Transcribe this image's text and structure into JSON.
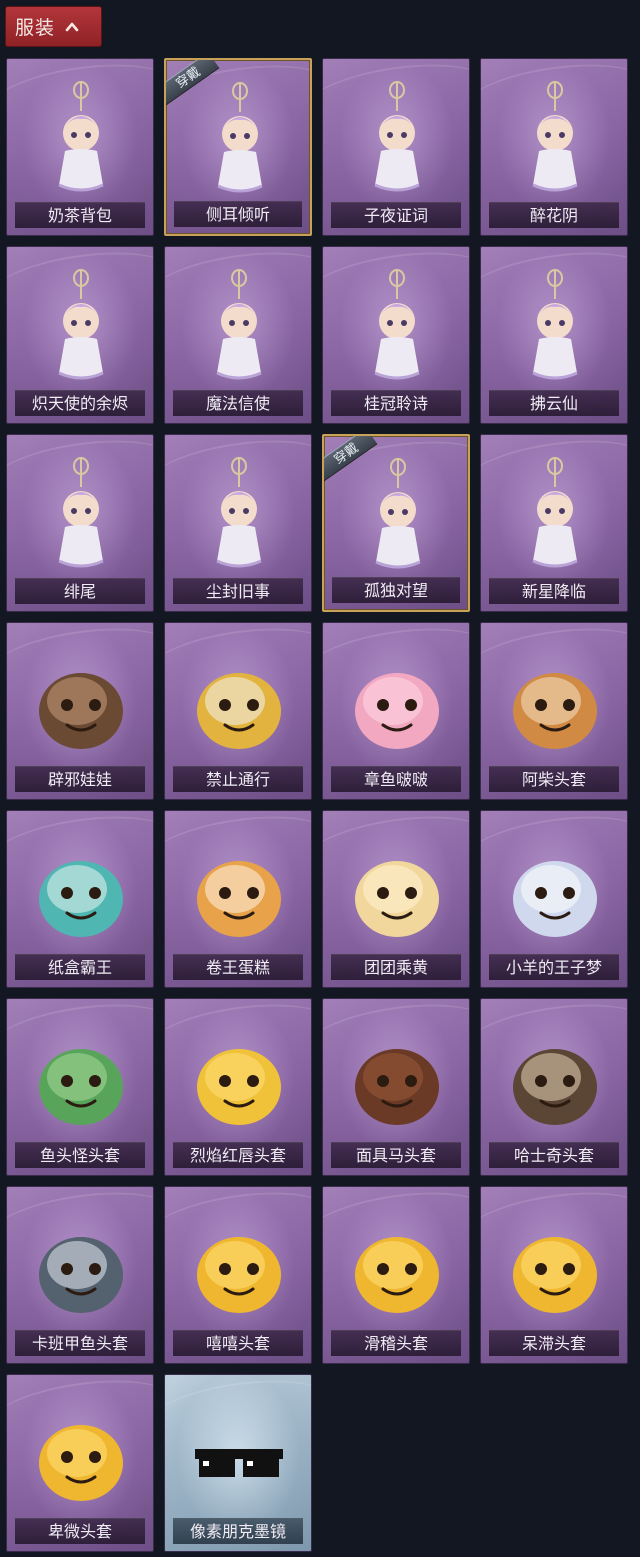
{
  "header": {
    "title": "服装",
    "icon": "chevron-up-icon"
  },
  "items": [
    {
      "name": "奶茶背包",
      "icon": "milk-tea-backpack-icon",
      "badge": ""
    },
    {
      "name": "侧耳倾听",
      "icon": "lotus-wreath-charm-icon",
      "badge": "穿戴"
    },
    {
      "name": "子夜证词",
      "icon": "plague-doctor-charm-icon",
      "badge": ""
    },
    {
      "name": "醉花阴",
      "icon": "flower-dreamcatcher-charm-icon",
      "badge": ""
    },
    {
      "name": "炽天使的余烬",
      "icon": "angel-doll-charm-icon",
      "badge": ""
    },
    {
      "name": "魔法信使",
      "icon": "elephant-charm-icon",
      "badge": ""
    },
    {
      "name": "桂冠聆诗",
      "icon": "laurel-doll-charm-icon",
      "badge": ""
    },
    {
      "name": "拂云仙",
      "icon": "cloud-fairy-charm-icon",
      "badge": ""
    },
    {
      "name": "绯尾",
      "icon": "fox-girl-charm-icon",
      "badge": ""
    },
    {
      "name": "尘封旧事",
      "icon": "crowned-boy-charm-icon",
      "badge": ""
    },
    {
      "name": "孤独对望",
      "icon": "white-hair-doll-charm-icon",
      "badge": "穿戴"
    },
    {
      "name": "新星降临",
      "icon": "star-doll-charm-icon",
      "badge": ""
    },
    {
      "name": "辟邪娃娃",
      "icon": "doll-head-mask-icon",
      "badge": ""
    },
    {
      "name": "禁止通行",
      "icon": "traffic-cone-mask-icon",
      "badge": ""
    },
    {
      "name": "章鱼啵啵",
      "icon": "octopus-mask-icon",
      "badge": ""
    },
    {
      "name": "阿柴头套",
      "icon": "shiba-mask-icon",
      "badge": ""
    },
    {
      "name": "纸盒霸王",
      "icon": "cardboard-dino-mask-icon",
      "badge": ""
    },
    {
      "name": "卷王蛋糕",
      "icon": "roll-cake-mask-icon",
      "badge": ""
    },
    {
      "name": "团团乘黄",
      "icon": "chubby-cat-mask-icon",
      "badge": ""
    },
    {
      "name": "小羊的王子梦",
      "icon": "sheep-prince-mask-icon",
      "badge": ""
    },
    {
      "name": "鱼头怪头套",
      "icon": "fish-head-mask-icon",
      "badge": ""
    },
    {
      "name": "烈焰红唇头套",
      "icon": "pikachu-lips-mask-icon",
      "badge": ""
    },
    {
      "name": "面具马头套",
      "icon": "horse-mask-icon",
      "badge": ""
    },
    {
      "name": "哈士奇头套",
      "icon": "husky-mask-icon",
      "badge": ""
    },
    {
      "name": "卡班甲鱼头套",
      "icon": "fish-ball-mask-icon",
      "badge": ""
    },
    {
      "name": "嘻嘻头套",
      "icon": "grin-emoji-mask-icon",
      "badge": ""
    },
    {
      "name": "滑稽头套",
      "icon": "smirk-emoji-mask-icon",
      "badge": ""
    },
    {
      "name": "呆滞头套",
      "icon": "stare-emoji-mask-icon",
      "badge": ""
    },
    {
      "name": "卑微头套",
      "icon": "humble-emoji-mask-icon",
      "badge": ""
    },
    {
      "name": "像素朋克墨镜",
      "icon": "pixel-sunglasses-icon",
      "badge": ""
    }
  ],
  "colors": {
    "background": "#121722",
    "header": "#a02c31",
    "card": "#8b67a4",
    "card_rare": "#9ab2c4",
    "equipped_border": "#c9a25a"
  }
}
